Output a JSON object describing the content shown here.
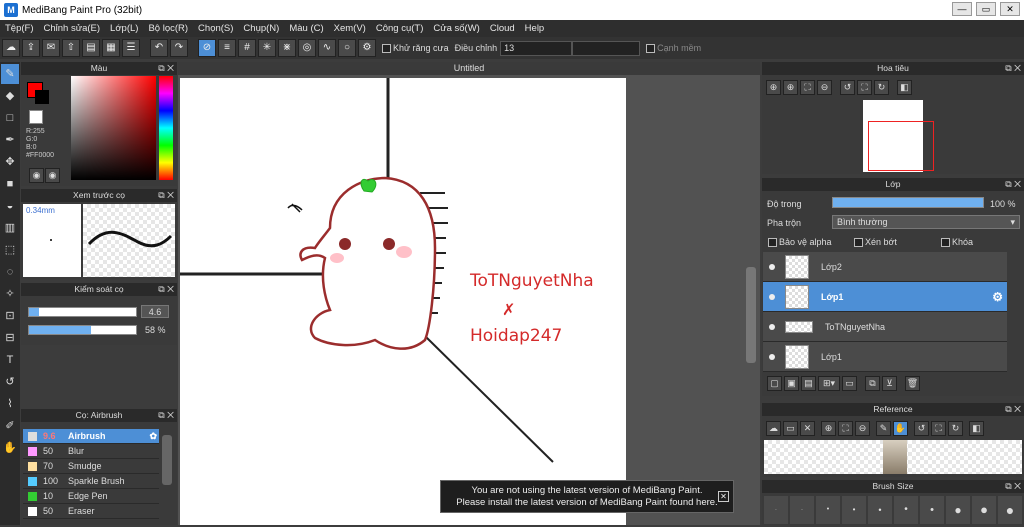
{
  "window": {
    "title": "MediBang Paint Pro (32bit)",
    "min": "—",
    "max": "▭",
    "close": "✕"
  },
  "menu": [
    "Tệp(F)",
    "Chỉnh sửa(E)",
    "Lớp(L)",
    "Bộ lọc(R)",
    "Chọn(S)",
    "Chụp(N)",
    "Màu (C)",
    "Xem(V)",
    "Công cụ(T)",
    "Cửa số(W)",
    "Cloud",
    "Help"
  ],
  "toolbar": {
    "antialias_label": "Khử răng cưa",
    "adjust_label": "Điều chỉnh",
    "adjust_value": "13",
    "snap_label": "Cạnh mềm"
  },
  "color_panel": {
    "title": "Màu",
    "primary": "#FF0000",
    "r": "R:255",
    "g": "G:0",
    "b": "B:0",
    "hex": "#FF0000"
  },
  "brush_preview": {
    "title": "Xem trước cọ",
    "size": "0.34mm"
  },
  "brush_control": {
    "title": "Kiểm soát cọ",
    "size_value": "4.6",
    "opacity_value": "58 %",
    "size_fraction": 0.09,
    "opacity_fraction": 0.58
  },
  "brush_list": {
    "title": "Cọ: Airbrush",
    "items": [
      {
        "size": "9.6",
        "name": "Airbrush",
        "color": "#dddddd"
      },
      {
        "size": "50",
        "name": "Blur",
        "color": "#ff99ff"
      },
      {
        "size": "70",
        "name": "Smudge",
        "color": "#ffe0a0"
      },
      {
        "size": "100",
        "name": "Sparkle Brush",
        "color": "#55ccff"
      },
      {
        "size": "10",
        "name": "Edge Pen",
        "color": "#33cc33"
      },
      {
        "size": "50",
        "name": "Eraser",
        "color": "#ffffff"
      }
    ]
  },
  "canvas": {
    "tab": "Untitled",
    "text1": "ToTNguyetNha",
    "text2": "Hoidap247"
  },
  "notice": {
    "line1": "You are not using the latest version of MediBang Paint.",
    "line2": "Please install the latest version of MediBang Paint found here."
  },
  "navigator": {
    "title": "Hoa tiêu"
  },
  "layers": {
    "title": "Lớp",
    "opacity_label": "Độ trong",
    "opacity_value": "100 %",
    "blend_label": "Pha trộn",
    "blend_value": "Bình thường",
    "protect_alpha": "Bảo vệ alpha",
    "clipping": "Xén bớt",
    "lock": "Khóa",
    "items": [
      {
        "name": "Lớp2",
        "active": false
      },
      {
        "name": "Lớp1",
        "active": true
      },
      {
        "name": "ToTNguyetNha",
        "active": false
      },
      {
        "name": "Lớp1",
        "active": false
      }
    ]
  },
  "reference": {
    "title": "Reference"
  },
  "brush_size": {
    "title": "Brush Size"
  }
}
